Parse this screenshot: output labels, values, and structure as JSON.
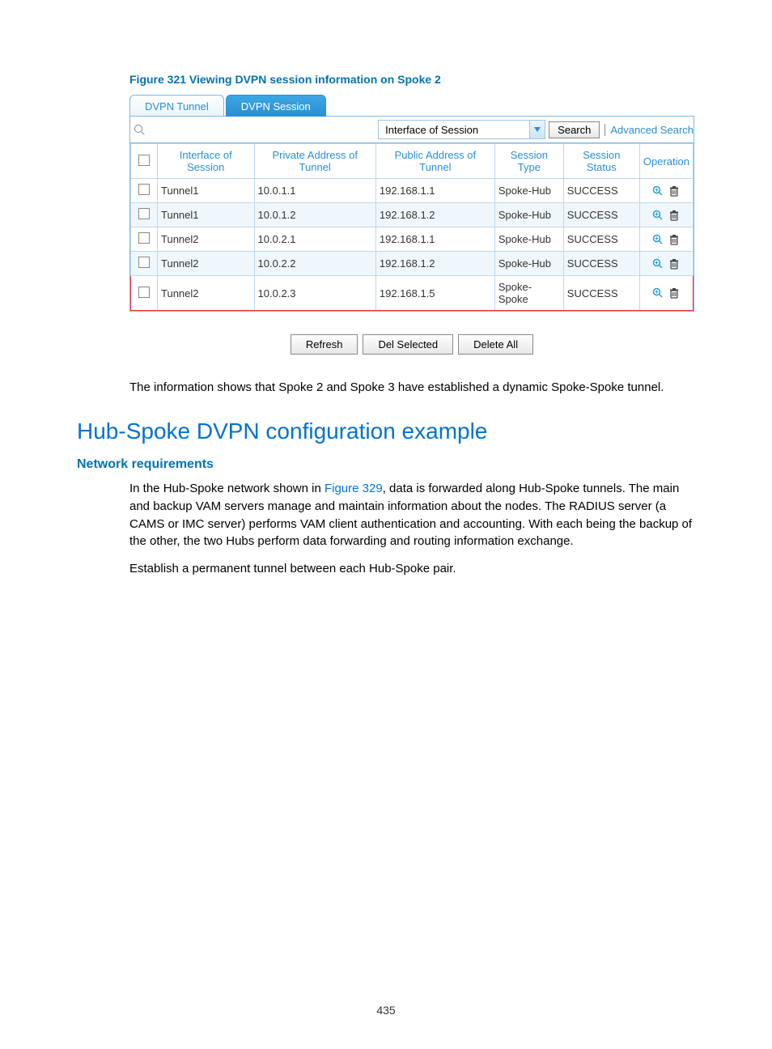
{
  "figure_caption": "Figure 321 Viewing DVPN session information on Spoke 2",
  "tabs": {
    "tunnel": "DVPN Tunnel",
    "session": "DVPN Session"
  },
  "search": {
    "placeholder": "",
    "dropdown": "Interface of Session",
    "button": "Search",
    "advanced": "Advanced Search"
  },
  "headers": {
    "iface": "Interface of Session",
    "priv": "Private Address of Tunnel",
    "pub": "Public Address of Tunnel",
    "type": "Session Type",
    "status": "Session Status",
    "op": "Operation"
  },
  "rows": [
    {
      "iface": "Tunnel1",
      "priv": "10.0.1.1",
      "pub": "192.168.1.1",
      "type": "Spoke-Hub",
      "status": "SUCCESS",
      "alt": false,
      "hl": false
    },
    {
      "iface": "Tunnel1",
      "priv": "10.0.1.2",
      "pub": "192.168.1.2",
      "type": "Spoke-Hub",
      "status": "SUCCESS",
      "alt": true,
      "hl": false
    },
    {
      "iface": "Tunnel2",
      "priv": "10.0.2.1",
      "pub": "192.168.1.1",
      "type": "Spoke-Hub",
      "status": "SUCCESS",
      "alt": false,
      "hl": false
    },
    {
      "iface": "Tunnel2",
      "priv": "10.0.2.2",
      "pub": "192.168.1.2",
      "type": "Spoke-Hub",
      "status": "SUCCESS",
      "alt": true,
      "hl": false
    },
    {
      "iface": "Tunnel2",
      "priv": "10.0.2.3",
      "pub": "192.168.1.5",
      "type": "Spoke-Spoke",
      "status": "SUCCESS",
      "alt": false,
      "hl": true
    }
  ],
  "buttons": {
    "refresh": "Refresh",
    "del_sel": "Del Selected",
    "del_all": "Delete All"
  },
  "caption_text": "The information shows that Spoke 2 and Spoke 3 have established a dynamic Spoke-Spoke tunnel.",
  "section_title": "Hub-Spoke DVPN configuration example",
  "subsection_title": "Network requirements",
  "para1_a": "In the Hub-Spoke network shown in ",
  "para1_link": "Figure 329",
  "para1_b": ", data is forwarded along Hub-Spoke tunnels. The main and backup VAM servers manage and maintain information about the nodes. The RADIUS server (a CAMS or IMC server) performs VAM client authentication and accounting. With each being the backup of the other, the two Hubs perform data forwarding and routing information exchange.",
  "para2": "Establish a permanent tunnel between each Hub-Spoke pair.",
  "page_num": "435"
}
